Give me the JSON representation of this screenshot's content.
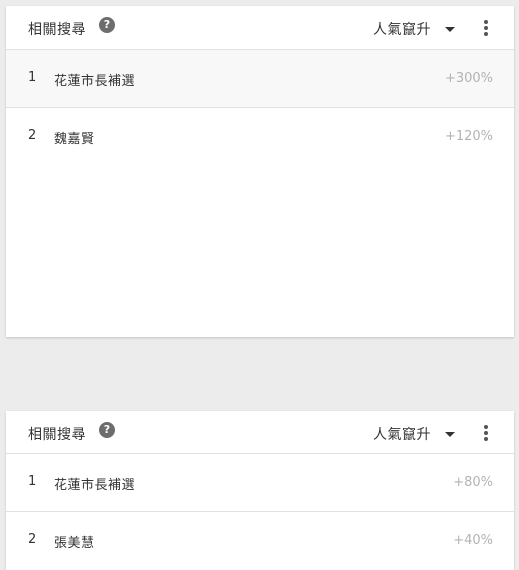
{
  "colors": {
    "background": "#ececec",
    "card": "#ffffff",
    "divider": "#e2e2e2",
    "highlight_row": "#f8f8f8",
    "value_text": "#b3b3b3"
  },
  "icons": {
    "help": "help-circle-icon",
    "caret": "caret-down-icon",
    "menu": "more-vertical-icon"
  },
  "widgets": [
    {
      "title": "相關搜尋",
      "help_glyph": "?",
      "sort_label": "人氣竄升",
      "rows": [
        {
          "rank": "1",
          "term": "花蓮市長補選",
          "value": "+300%"
        },
        {
          "rank": "2",
          "term": "魏嘉賢",
          "value": "+120%"
        }
      ]
    },
    {
      "title": "相關搜尋",
      "help_glyph": "?",
      "sort_label": "人氣竄升",
      "rows": [
        {
          "rank": "1",
          "term": "花蓮市長補選",
          "value": "+80%"
        },
        {
          "rank": "2",
          "term": "張美慧",
          "value": "+40%"
        }
      ]
    }
  ]
}
